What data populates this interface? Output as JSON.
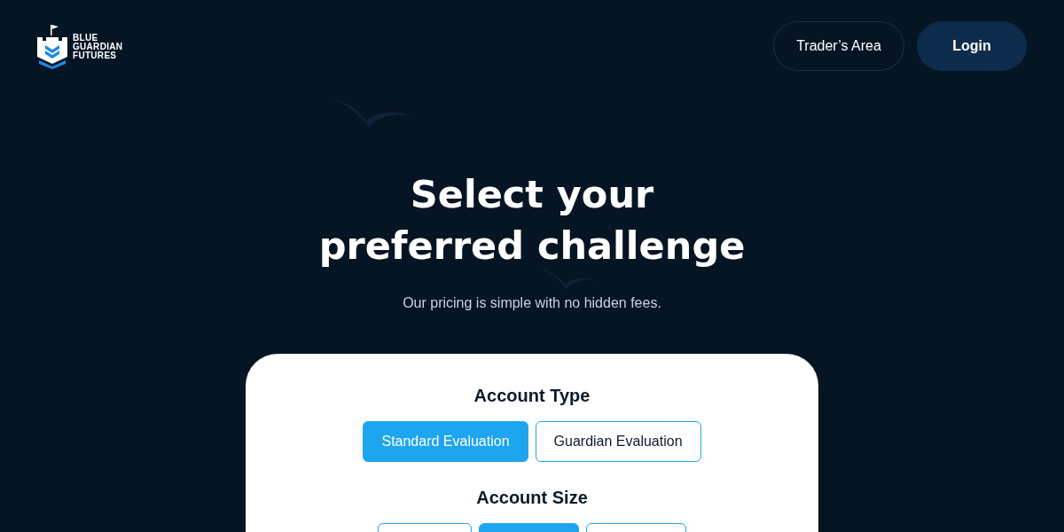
{
  "header": {
    "logo_lines": [
      "BLUE",
      "GUARDIAN",
      "FUTURES"
    ],
    "buttons": [
      {
        "label": "Trader’s Area",
        "kind": "outline"
      },
      {
        "label": "Login",
        "kind": "filled"
      }
    ]
  },
  "hero": {
    "title_lines": [
      "Select your",
      "preferred challenge"
    ],
    "subtitle": "Our pricing is simple with no hidden fees."
  },
  "card": {
    "sections": [
      {
        "heading": "Account Type",
        "options": [
          {
            "label": "Standard Evaluation",
            "selected": true
          },
          {
            "label": "Guardian Evaluation",
            "selected": false
          }
        ]
      },
      {
        "heading": "Account Size",
        "options": [
          {
            "selected": false
          },
          {
            "selected": true
          },
          {
            "selected": false
          }
        ]
      }
    ]
  }
}
